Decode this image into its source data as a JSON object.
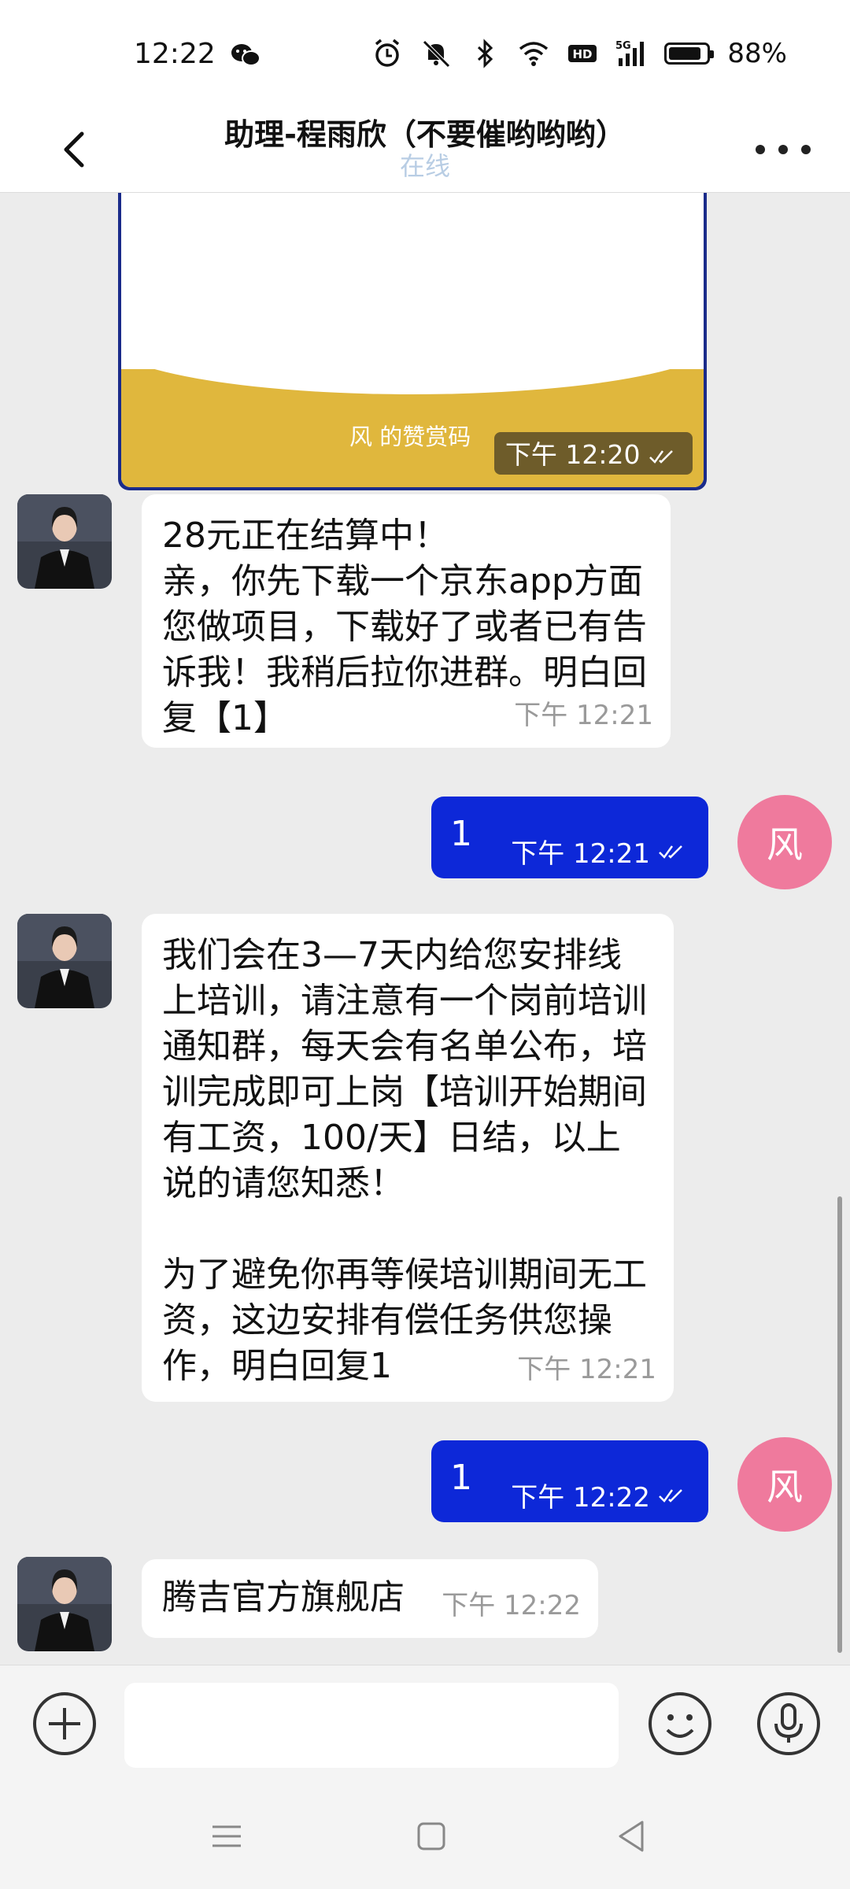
{
  "status_bar": {
    "time": "12:22",
    "network": "5G",
    "battery": "88%",
    "battery_level": 0.88,
    "icons": [
      "wechat-icon",
      "alarm-icon",
      "mute-icon",
      "bluetooth-icon",
      "wifi-icon",
      "hd-icon",
      "signal-icon",
      "battery-icon"
    ]
  },
  "header": {
    "title": "助理-程雨欣（不要催哟哟哟）",
    "subtitle": "在线",
    "back_icon": "chevron-left-icon",
    "more_icon": "more-dots-icon"
  },
  "messages": [
    {
      "type": "image",
      "side": "out",
      "label": "风 的赞赏码",
      "time": "下午  12:20",
      "read": true
    },
    {
      "type": "text",
      "side": "in",
      "text": "28元正在结算中！\n亲，你先下载一个京东app方面您做项目，下载好了或者已有告诉我！我稍后拉你进群。明白回复【1】",
      "time": "下午  12:21"
    },
    {
      "type": "text",
      "side": "out",
      "avatar_text": "风",
      "text": "1",
      "time": "下午  12:21",
      "read": true
    },
    {
      "type": "text",
      "side": "in",
      "text": "我们会在3—7天内给您安排线上培训，请注意有一个岗前培训通知群，每天会有名单公布，培训完成即可上岗【培训开始期间有工资，100/天】日结，以上说的请您知悉！\n\n为了避免你再等候培训期间无工资，这边安排有偿任务供您操作，明白回复1",
      "time": "下午  12:21"
    },
    {
      "type": "text",
      "side": "out",
      "avatar_text": "风",
      "text": "1",
      "time": "下午  12:22",
      "read": true
    },
    {
      "type": "text",
      "side": "in",
      "text": "腾吉官方旗舰店",
      "time": "下午  12:22"
    }
  ],
  "input_bar": {
    "placeholder": "",
    "value": "",
    "icons": [
      "plus-icon",
      "emoji-icon",
      "microphone-icon"
    ]
  },
  "nav_bar": {
    "icons": [
      "menu-icon",
      "home-icon",
      "back-triangle-icon"
    ]
  },
  "colors": {
    "outgoing_bubble": "#0d28d8",
    "self_avatar": "#ef7a9d",
    "chat_background": "#ececec",
    "reward_gold": "#e0b73d"
  }
}
